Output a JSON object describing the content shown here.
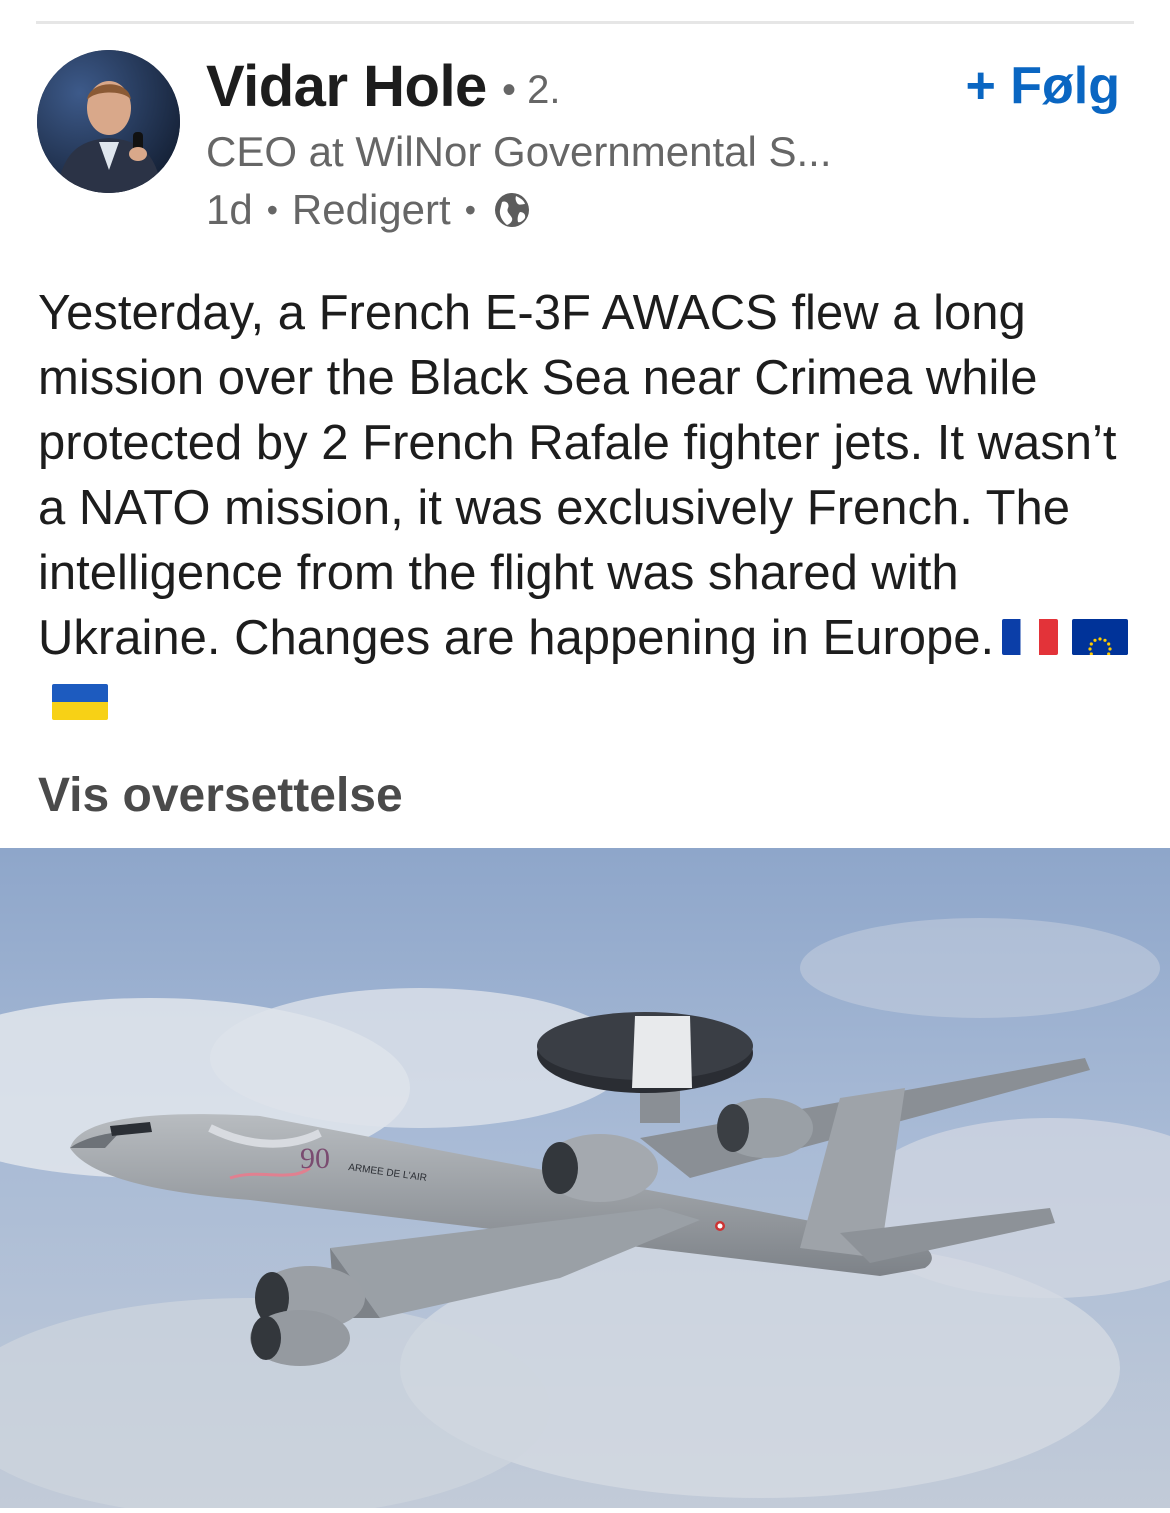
{
  "author": {
    "name": "Vidar Hole",
    "degree": "• 2.",
    "headline": "CEO at WilNor Governmental S...",
    "time": "1d",
    "edited": "Redigert",
    "visibility_icon": "globe-icon"
  },
  "actions": {
    "follow_label": "+ Følg",
    "translate_label": "Vis oversettelse"
  },
  "post": {
    "text": "Yesterday, a French E-3F AWACS flew a long mission over the Black Sea near Crimea while protected by 2 French Rafale fighter jets. It wasn’t a NATO mission, it was exclusively French. The intelligence from the flight was shared with Ukraine. Changes are happening in Europe.",
    "emoji_flags": [
      "flag-france-icon",
      "flag-eu-icon",
      "flag-ukraine-icon"
    ]
  },
  "image": {
    "description_icon": "awacs-aircraft-photo",
    "fuselage_text": "ARMEE DE L'AIR",
    "anniversary_mark": "90"
  },
  "colors": {
    "accent": "#0a66c2",
    "text_primary": "#1d1d1d",
    "text_secondary": "#666666"
  }
}
